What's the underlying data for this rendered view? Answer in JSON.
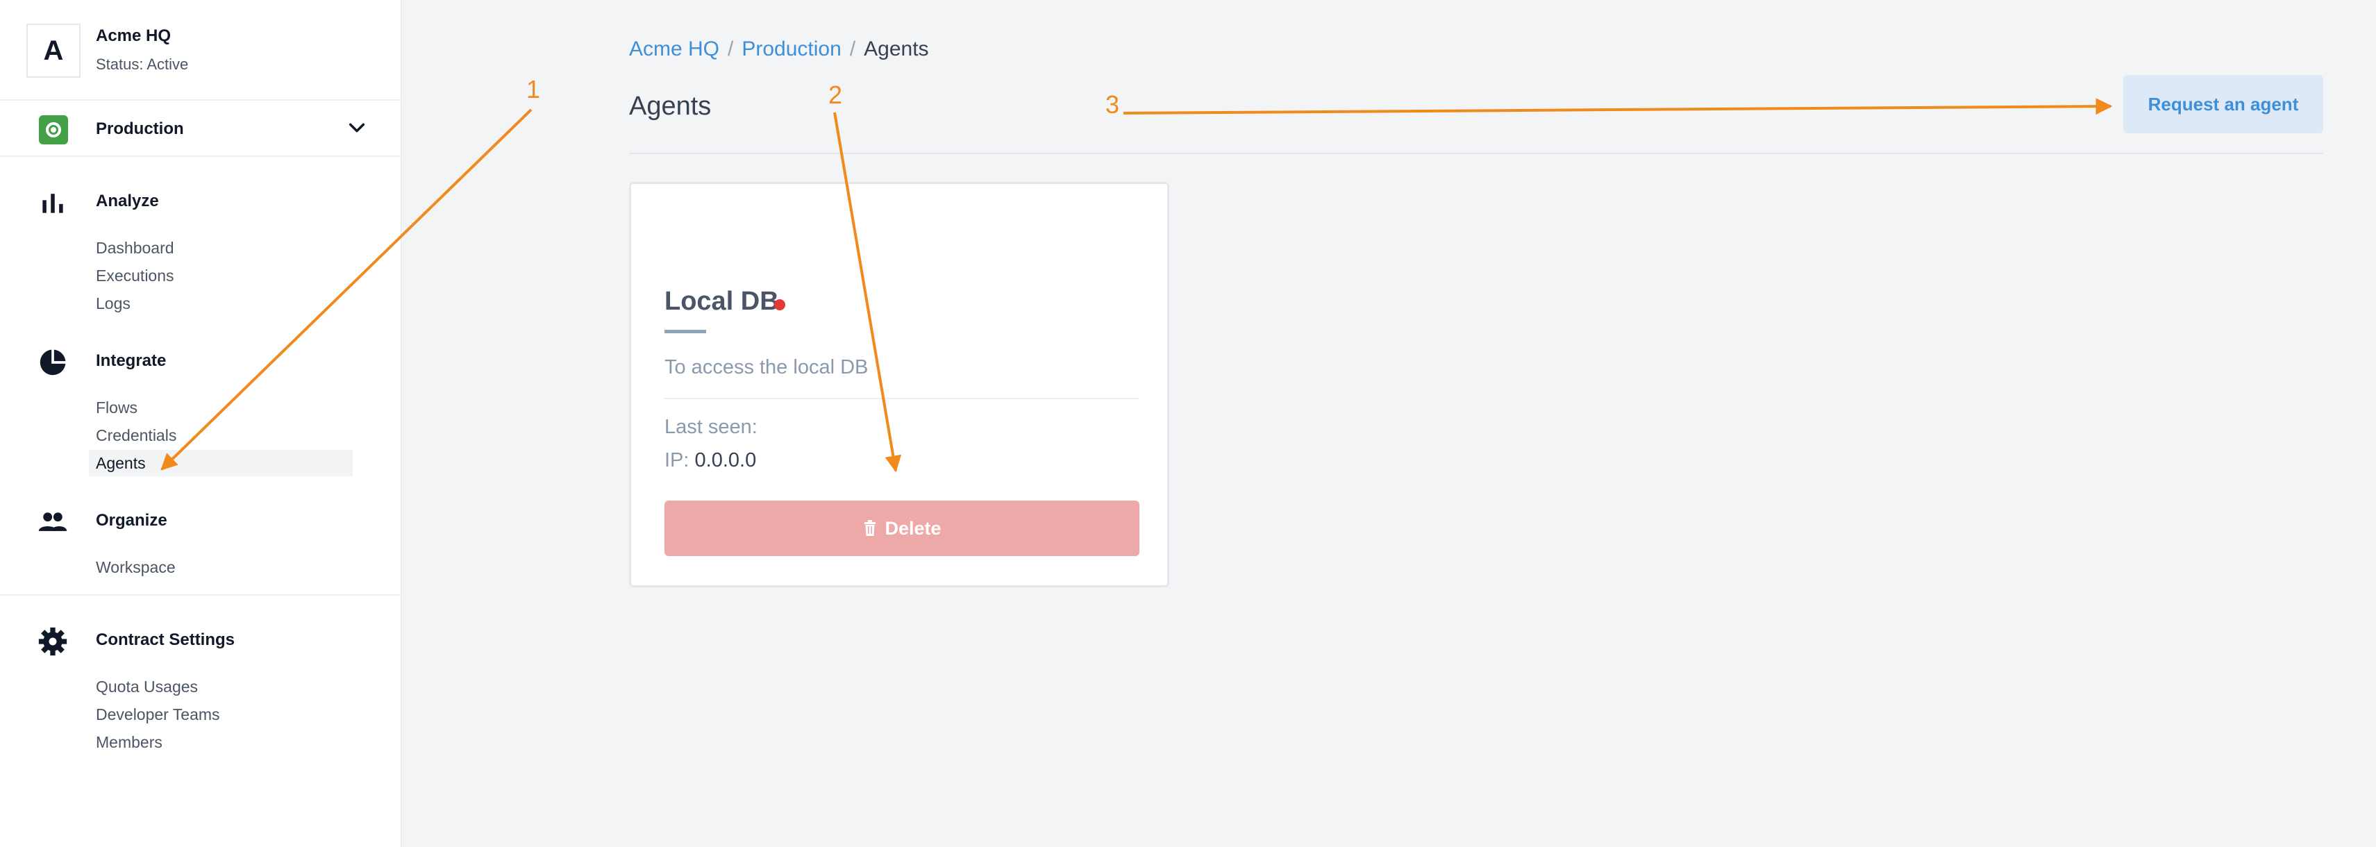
{
  "org": {
    "initial": "A",
    "name": "Acme HQ",
    "status": "Status: Active"
  },
  "environment": {
    "label": "Production",
    "icon": "environment-icon"
  },
  "sidebar": {
    "sections": [
      {
        "label": "Analyze",
        "icon": "bar-chart-icon",
        "items": [
          "Dashboard",
          "Executions",
          "Logs"
        ]
      },
      {
        "label": "Integrate",
        "icon": "pie-chart-icon",
        "items": [
          "Flows",
          "Credentials",
          "Agents"
        ]
      },
      {
        "label": "Organize",
        "icon": "people-icon",
        "items": [
          "Workspace"
        ]
      },
      {
        "label": "Contract Settings",
        "icon": "gear-icon",
        "items": [
          "Quota Usages",
          "Developer Teams",
          "Members"
        ]
      }
    ],
    "active_item": "Agents"
  },
  "breadcrumb": {
    "items": [
      "Acme HQ",
      "Production",
      "Agents"
    ],
    "separator": "/"
  },
  "page": {
    "title": "Agents",
    "request_button": "Request an agent"
  },
  "agent_card": {
    "name": "Local DB",
    "status_color": "#e53935",
    "description": "To access the local DB",
    "last_seen_label": "Last seen:",
    "ip_label": "IP:",
    "ip_value": "0.0.0.0",
    "delete_label": "Delete"
  },
  "annotations": {
    "labels": [
      "1",
      "2",
      "3"
    ],
    "color": "#f08a1c"
  },
  "colors": {
    "accent": "#3f8fd8",
    "environment": "#43a047",
    "danger": "#eda8a8"
  }
}
